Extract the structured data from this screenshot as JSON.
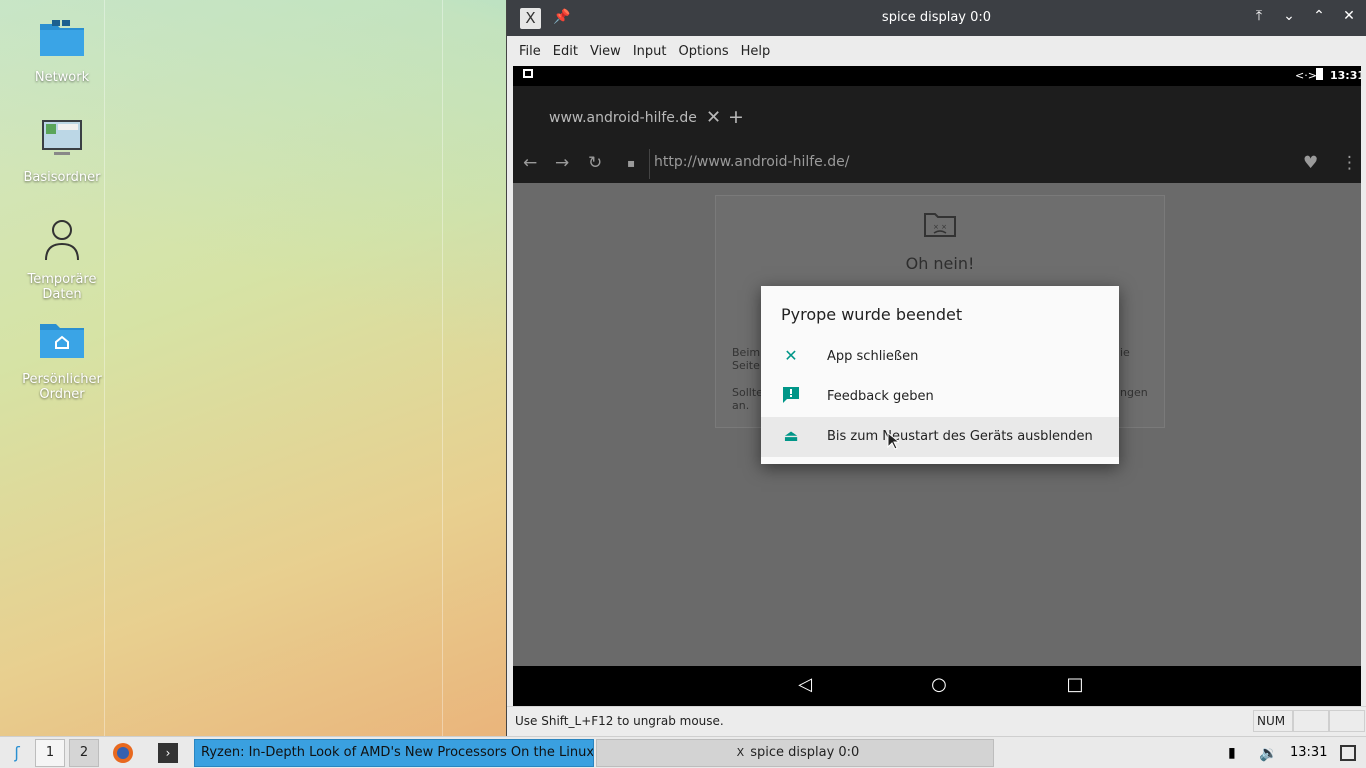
{
  "desktop": {
    "icons": [
      {
        "label": "Network",
        "icon": "network-folder-icon"
      },
      {
        "label": "Basisordner",
        "icon": "computer-icon"
      },
      {
        "label": "Temporäre Daten",
        "icon": "user-icon"
      },
      {
        "label": "Persönlicher Ordner",
        "icon": "home-folder-icon"
      }
    ]
  },
  "window": {
    "title": "spice display 0:0",
    "menu": [
      "File",
      "Edit",
      "View",
      "Input",
      "Options",
      "Help"
    ],
    "status_message": "Use Shift_L+F12 to ungrab mouse.",
    "status_num": "NUM"
  },
  "android": {
    "clock": "13:31",
    "tab_title": "www.android-hilfe.de",
    "url": "http://www.android-hilfe.de/",
    "error_title": "Oh nein!",
    "error_text_1a": "Beim",
    "error_text_1b": "Seite",
    "error_text_1c": "ie",
    "error_text_2a": "Sollte",
    "error_text_2b": "an.",
    "error_text_2c": "ngen",
    "dialog": {
      "title": "Pyrope wurde beendet",
      "items": [
        {
          "label": "App schließen",
          "icon": "close-icon"
        },
        {
          "label": "Feedback geben",
          "icon": "feedback-icon"
        },
        {
          "label": "Bis zum Neustart des Geräts ausblenden",
          "icon": "eject-icon"
        }
      ]
    }
  },
  "taskbar": {
    "workspaces": [
      "1",
      "2"
    ],
    "tasks": [
      {
        "label": "Ryzen: In-Depth Look of AMD's New Processors On the Linux"
      },
      {
        "label": "spice display 0:0"
      }
    ],
    "clock": "13:31"
  }
}
